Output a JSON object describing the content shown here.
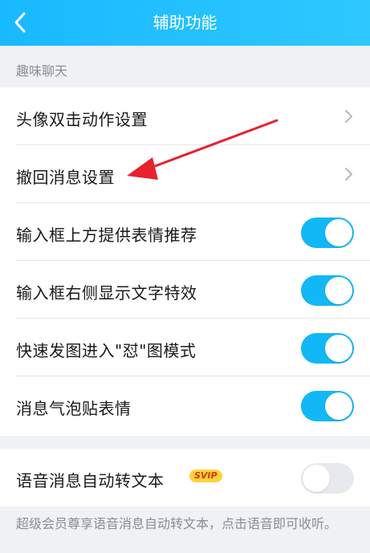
{
  "header": {
    "title": "辅助功能",
    "back_icon": "chevron-left-icon",
    "color": "#19b9ff"
  },
  "section": {
    "title": "趣味聊天"
  },
  "items": [
    {
      "label": "头像双击动作设置",
      "control": "chevron"
    },
    {
      "label": "撤回消息设置",
      "control": "chevron"
    },
    {
      "label": "输入框上方提供表情推荐",
      "control": "toggle",
      "on": true
    },
    {
      "label": "输入框右侧显示文字特效",
      "control": "toggle",
      "on": true
    },
    {
      "label": "快速发图进入\"怼\"图模式",
      "control": "toggle",
      "on": true
    },
    {
      "label": "消息气泡贴表情",
      "control": "toggle",
      "on": true
    }
  ],
  "voice_item": {
    "label": "语音消息自动转文本",
    "badge": "SVIP",
    "on": false
  },
  "footnote": "超级会员尊享语音消息自动转文本，点击语音即可收听。",
  "colors": {
    "toggle_on": "#12b7f5",
    "toggle_off": "#e7e9ef",
    "annotation_arrow": "#e8212e"
  }
}
